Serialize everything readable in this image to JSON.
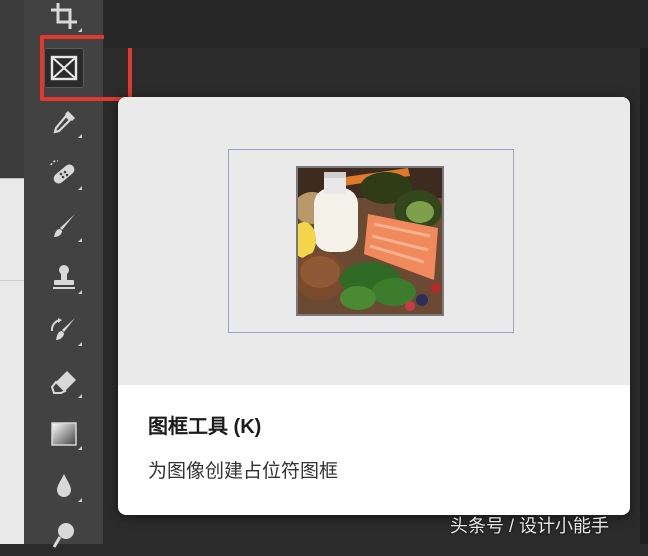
{
  "tooltip": {
    "title": "图框工具 (K)",
    "description": "为图像创建占位符图框"
  },
  "watermark": "头条号 / 设计小能手",
  "toolbar": {
    "tools": [
      {
        "icon": "crop-icon"
      },
      {
        "icon": "frame-tool-icon",
        "active": true
      },
      {
        "icon": "eyedropper-icon"
      },
      {
        "icon": "spot-healing-brush-icon"
      },
      {
        "icon": "brush-icon"
      },
      {
        "icon": "clone-stamp-icon"
      },
      {
        "icon": "history-brush-icon"
      },
      {
        "icon": "eraser-icon"
      },
      {
        "icon": "gradient-icon"
      },
      {
        "icon": "blur-drop-icon"
      },
      {
        "icon": "dodge-icon"
      }
    ]
  },
  "colors": {
    "highlight": "#e03a2f",
    "toolbar": "#424242",
    "tooltip_bg": "#ffffff",
    "preview_bg": "#eaeaeb"
  }
}
